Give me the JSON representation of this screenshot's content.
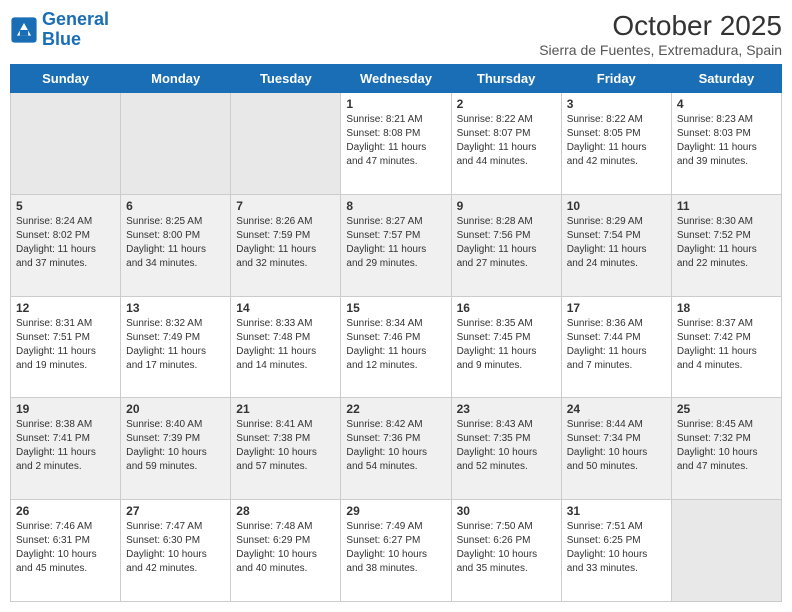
{
  "logo": {
    "line1": "General",
    "line2": "Blue"
  },
  "title": "October 2025",
  "subtitle": "Sierra de Fuentes, Extremadura, Spain",
  "days_of_week": [
    "Sunday",
    "Monday",
    "Tuesday",
    "Wednesday",
    "Thursday",
    "Friday",
    "Saturday"
  ],
  "weeks": [
    [
      {
        "day": "",
        "info": ""
      },
      {
        "day": "",
        "info": ""
      },
      {
        "day": "",
        "info": ""
      },
      {
        "day": "1",
        "info": "Sunrise: 8:21 AM\nSunset: 8:08 PM\nDaylight: 11 hours and 47 minutes."
      },
      {
        "day": "2",
        "info": "Sunrise: 8:22 AM\nSunset: 8:07 PM\nDaylight: 11 hours and 44 minutes."
      },
      {
        "day": "3",
        "info": "Sunrise: 8:22 AM\nSunset: 8:05 PM\nDaylight: 11 hours and 42 minutes."
      },
      {
        "day": "4",
        "info": "Sunrise: 8:23 AM\nSunset: 8:03 PM\nDaylight: 11 hours and 39 minutes."
      }
    ],
    [
      {
        "day": "5",
        "info": "Sunrise: 8:24 AM\nSunset: 8:02 PM\nDaylight: 11 hours and 37 minutes."
      },
      {
        "day": "6",
        "info": "Sunrise: 8:25 AM\nSunset: 8:00 PM\nDaylight: 11 hours and 34 minutes."
      },
      {
        "day": "7",
        "info": "Sunrise: 8:26 AM\nSunset: 7:59 PM\nDaylight: 11 hours and 32 minutes."
      },
      {
        "day": "8",
        "info": "Sunrise: 8:27 AM\nSunset: 7:57 PM\nDaylight: 11 hours and 29 minutes."
      },
      {
        "day": "9",
        "info": "Sunrise: 8:28 AM\nSunset: 7:56 PM\nDaylight: 11 hours and 27 minutes."
      },
      {
        "day": "10",
        "info": "Sunrise: 8:29 AM\nSunset: 7:54 PM\nDaylight: 11 hours and 24 minutes."
      },
      {
        "day": "11",
        "info": "Sunrise: 8:30 AM\nSunset: 7:52 PM\nDaylight: 11 hours and 22 minutes."
      }
    ],
    [
      {
        "day": "12",
        "info": "Sunrise: 8:31 AM\nSunset: 7:51 PM\nDaylight: 11 hours and 19 minutes."
      },
      {
        "day": "13",
        "info": "Sunrise: 8:32 AM\nSunset: 7:49 PM\nDaylight: 11 hours and 17 minutes."
      },
      {
        "day": "14",
        "info": "Sunrise: 8:33 AM\nSunset: 7:48 PM\nDaylight: 11 hours and 14 minutes."
      },
      {
        "day": "15",
        "info": "Sunrise: 8:34 AM\nSunset: 7:46 PM\nDaylight: 11 hours and 12 minutes."
      },
      {
        "day": "16",
        "info": "Sunrise: 8:35 AM\nSunset: 7:45 PM\nDaylight: 11 hours and 9 minutes."
      },
      {
        "day": "17",
        "info": "Sunrise: 8:36 AM\nSunset: 7:44 PM\nDaylight: 11 hours and 7 minutes."
      },
      {
        "day": "18",
        "info": "Sunrise: 8:37 AM\nSunset: 7:42 PM\nDaylight: 11 hours and 4 minutes."
      }
    ],
    [
      {
        "day": "19",
        "info": "Sunrise: 8:38 AM\nSunset: 7:41 PM\nDaylight: 11 hours and 2 minutes."
      },
      {
        "day": "20",
        "info": "Sunrise: 8:40 AM\nSunset: 7:39 PM\nDaylight: 10 hours and 59 minutes."
      },
      {
        "day": "21",
        "info": "Sunrise: 8:41 AM\nSunset: 7:38 PM\nDaylight: 10 hours and 57 minutes."
      },
      {
        "day": "22",
        "info": "Sunrise: 8:42 AM\nSunset: 7:36 PM\nDaylight: 10 hours and 54 minutes."
      },
      {
        "day": "23",
        "info": "Sunrise: 8:43 AM\nSunset: 7:35 PM\nDaylight: 10 hours and 52 minutes."
      },
      {
        "day": "24",
        "info": "Sunrise: 8:44 AM\nSunset: 7:34 PM\nDaylight: 10 hours and 50 minutes."
      },
      {
        "day": "25",
        "info": "Sunrise: 8:45 AM\nSunset: 7:32 PM\nDaylight: 10 hours and 47 minutes."
      }
    ],
    [
      {
        "day": "26",
        "info": "Sunrise: 7:46 AM\nSunset: 6:31 PM\nDaylight: 10 hours and 45 minutes."
      },
      {
        "day": "27",
        "info": "Sunrise: 7:47 AM\nSunset: 6:30 PM\nDaylight: 10 hours and 42 minutes."
      },
      {
        "day": "28",
        "info": "Sunrise: 7:48 AM\nSunset: 6:29 PM\nDaylight: 10 hours and 40 minutes."
      },
      {
        "day": "29",
        "info": "Sunrise: 7:49 AM\nSunset: 6:27 PM\nDaylight: 10 hours and 38 minutes."
      },
      {
        "day": "30",
        "info": "Sunrise: 7:50 AM\nSunset: 6:26 PM\nDaylight: 10 hours and 35 minutes."
      },
      {
        "day": "31",
        "info": "Sunrise: 7:51 AM\nSunset: 6:25 PM\nDaylight: 10 hours and 33 minutes."
      },
      {
        "day": "",
        "info": ""
      }
    ]
  ]
}
